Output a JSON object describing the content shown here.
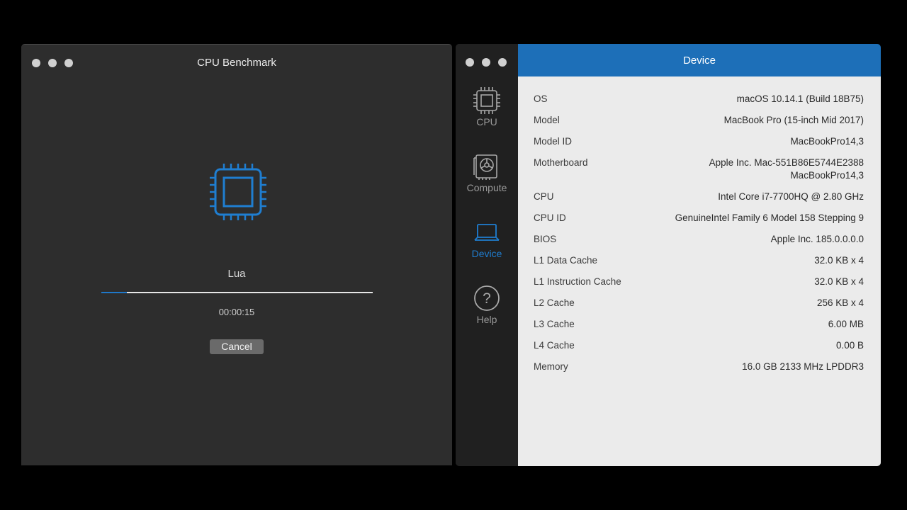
{
  "left_window": {
    "title": "CPU Benchmark",
    "benchmark_name": "Lua",
    "progress_fraction": 0.095,
    "elapsed": "00:00:15",
    "cancel_label": "Cancel",
    "icon": "cpu-chip-icon"
  },
  "right_window": {
    "header_title": "Device",
    "sidebar": [
      {
        "label": "CPU",
        "icon": "cpu-icon",
        "active": false
      },
      {
        "label": "Compute",
        "icon": "gpu-card-icon",
        "active": false
      },
      {
        "label": "Device",
        "icon": "laptop-icon",
        "active": true
      },
      {
        "label": "Help",
        "icon": "help-icon",
        "active": false
      }
    ],
    "rows": [
      {
        "key": "OS",
        "value": "macOS 10.14.1 (Build 18B75)"
      },
      {
        "key": "Model",
        "value": "MacBook Pro (15-inch Mid 2017)"
      },
      {
        "key": "Model ID",
        "value": "MacBookPro14,3"
      },
      {
        "key": "Motherboard",
        "value": "Apple Inc. Mac-551B86E5744E2388",
        "value2": "MacBookPro14,3"
      },
      {
        "key": "CPU",
        "value": "Intel Core i7-7700HQ @ 2.80 GHz"
      },
      {
        "key": "CPU ID",
        "value": "GenuineIntel Family 6 Model 158 Stepping 9"
      },
      {
        "key": "BIOS",
        "value": "Apple Inc. 185.0.0.0.0"
      },
      {
        "key": "L1 Data Cache",
        "value": "32.0 KB x 4"
      },
      {
        "key": "L1 Instruction Cache",
        "value": "32.0 KB x 4"
      },
      {
        "key": "L2 Cache",
        "value": "256 KB x 4"
      },
      {
        "key": "L3 Cache",
        "value": "6.00 MB"
      },
      {
        "key": "L4 Cache",
        "value": "0.00 B"
      },
      {
        "key": "Memory",
        "value": "16.0 GB 2133 MHz LPDDR3"
      }
    ]
  },
  "colors": {
    "accent": "#1d6fb8",
    "active_label": "#1f7ed1",
    "window_bg": "#2d2d2d",
    "sidebar_bg": "#202020",
    "content_bg": "#ebebeb"
  }
}
